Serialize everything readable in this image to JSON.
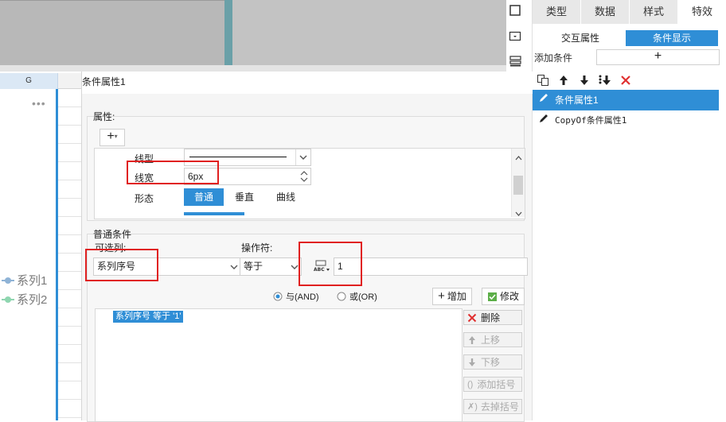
{
  "sheet": {
    "column_header": "G",
    "more_dots": "•••",
    "legend": [
      "系列1",
      "系列2"
    ]
  },
  "tools": {
    "icons": [
      "frame-icon",
      "widget-icon",
      "layer-icon"
    ]
  },
  "right_panel": {
    "tabs": [
      {
        "label": "类型",
        "active": false
      },
      {
        "label": "数据",
        "active": false
      },
      {
        "label": "样式",
        "active": false
      },
      {
        "label": "特效",
        "active": true
      }
    ],
    "sub_tabs": [
      {
        "label": "交互属性",
        "active": false
      },
      {
        "label": "条件显示",
        "active": true
      }
    ],
    "add_condition_label": "添加条件",
    "add_condition_button": "+",
    "toolbar": [
      "copy-icon",
      "move-up-icon",
      "move-down-icon",
      "move-bottom-icon",
      "delete-icon"
    ],
    "conditions": [
      {
        "label": "条件属性1",
        "selected": true
      },
      {
        "label": "CopyOf条件属性1",
        "selected": false
      }
    ]
  },
  "dialog": {
    "title": "条件属性1",
    "property_group": {
      "label": "属性:",
      "add_button": "+",
      "line_type_label": "线型",
      "line_width_label": "线宽",
      "line_width_value": "6px",
      "shape_label": "形态",
      "shape_options": [
        {
          "label": "普通",
          "active": true
        },
        {
          "label": "垂直",
          "active": false
        },
        {
          "label": "曲线",
          "active": false
        }
      ]
    },
    "condition_group": {
      "label": "普通条件",
      "column_label": "可选列:",
      "column_value": "系列序号",
      "operator_label": "操作符:",
      "operator_value": "等于",
      "value_type_icon": "ABC",
      "value": "1",
      "and_label": "与(AND)",
      "or_label": "或(OR)",
      "logic_selected": "and",
      "add_button": "增加",
      "modify_button": "修改",
      "condition_list": [
        "系列序号 等于 '1'"
      ],
      "side_buttons": [
        {
          "label": "删除",
          "enabled": true
        },
        {
          "label": "上移",
          "enabled": false
        },
        {
          "label": "下移",
          "enabled": false
        },
        {
          "label": "添加括号",
          "enabled": false
        },
        {
          "label": "去掉括号",
          "enabled": false
        }
      ]
    }
  },
  "colors": {
    "accent": "#2f8ed6",
    "highlight": "#e02020",
    "delete_red": "#e03030"
  }
}
